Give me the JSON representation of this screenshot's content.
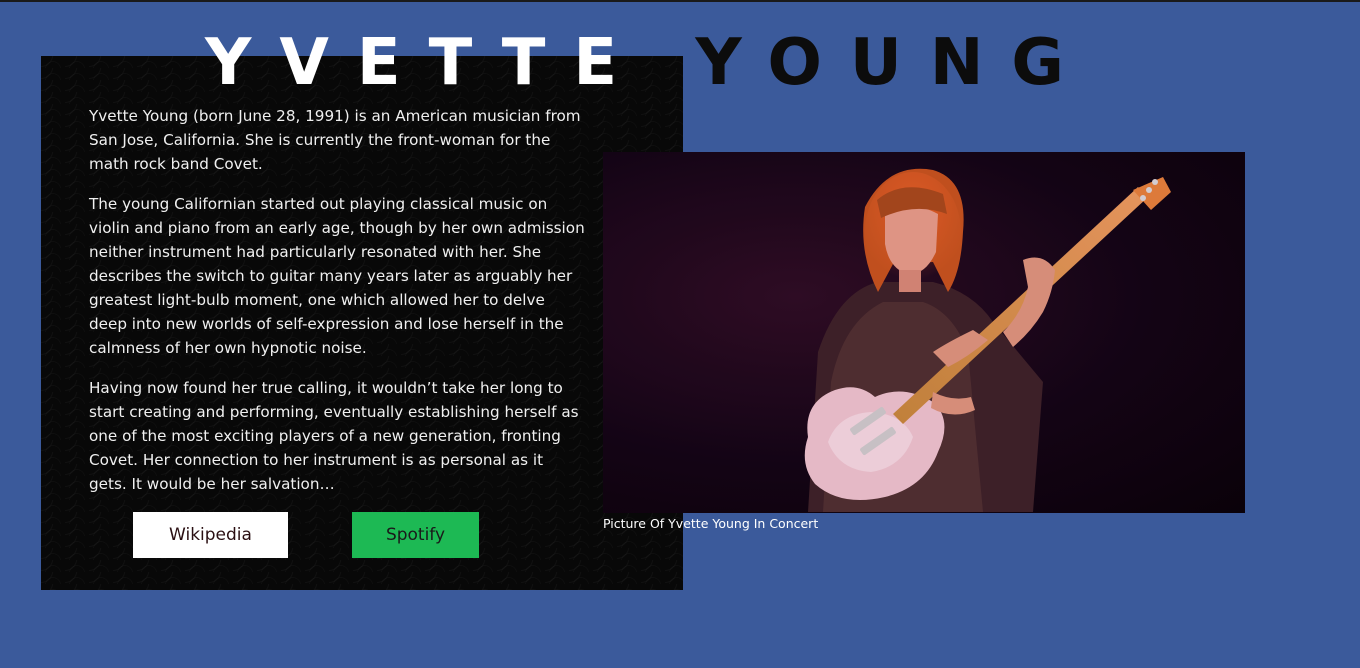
{
  "page": {
    "title_first": "YVETTE",
    "title_last": "YOUNG"
  },
  "bio": {
    "paragraphs": [
      "Yvette Young (born June 28, 1991) is an American musician from San Jose, California. She is currently the front-woman for the math rock band Covet.",
      "The young Californian started out playing classical music on violin and piano from an early age, though by her own admission neither instrument had particularly resonated with her. She describes the switch to guitar many years later as arguably her greatest light-bulb moment, one which allowed her to delve deep into new worlds of self-expression and lose herself in the calmness of her own hypnotic noise.",
      "Having now found her true calling, it wouldn’t take her long to start creating and performing, eventually establishing herself as one of the most exciting players of a new generation, fronting Covet. Her connection to her instrument is as personal as it gets. It would be her salvation…"
    ]
  },
  "links": {
    "wikipedia_label": "Wikipedia",
    "spotify_label": "Spotify"
  },
  "photo": {
    "caption": "Picture Of Yvette Young In Concert"
  },
  "colors": {
    "background": "#3b5a9b",
    "card": "#080808",
    "spotify": "#1db954"
  }
}
